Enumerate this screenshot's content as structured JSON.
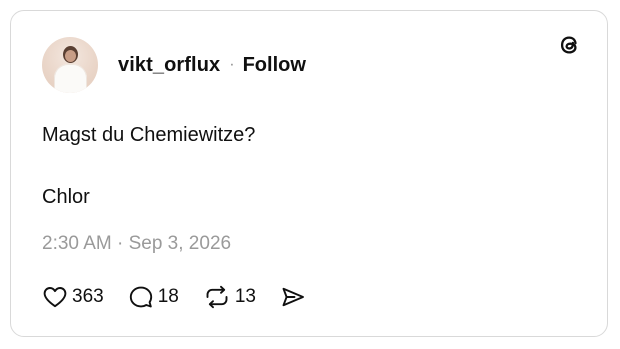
{
  "post": {
    "username": "vikt_orflux",
    "separator": "·",
    "follow_label": "Follow",
    "text_line1": "Magst du Chemiewitze?",
    "text_line2": "Chlor",
    "timestamp": "2:30 AM · Sep 3, 2026"
  },
  "actions": {
    "likes": "363",
    "replies": "18",
    "reposts": "13"
  },
  "icons": {
    "logo": "threads-logo-icon",
    "like": "heart-icon",
    "reply": "speech-bubble-icon",
    "repost": "repost-icon",
    "share": "send-icon"
  }
}
